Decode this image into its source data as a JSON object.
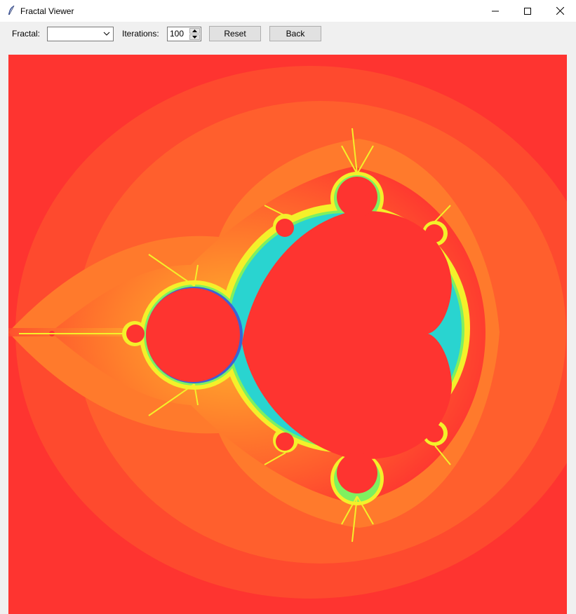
{
  "window": {
    "title": "Fractal Viewer",
    "icon": "feather-icon",
    "controls": [
      "minimize-icon",
      "maximize-icon",
      "close-icon"
    ]
  },
  "toolbar": {
    "fractal_label": "Fractal:",
    "fractal_value": "",
    "iterations_label": "Iterations:",
    "iterations_value": "100",
    "reset_label": "Reset",
    "back_label": "Back"
  },
  "canvas": {
    "fractal": "Mandelbrot set",
    "colors": {
      "background": "#fe3430",
      "outer_band": "#fe4a2e",
      "mid_band": "#ff6a2c",
      "inner_band": "#ffa12b",
      "edge_yellow": "#f4f02a",
      "edge_green": "#7ef060",
      "edge_cyan": "#29d4d0",
      "edge_blue": "#3b62d6",
      "interior": "#fe3430"
    }
  }
}
